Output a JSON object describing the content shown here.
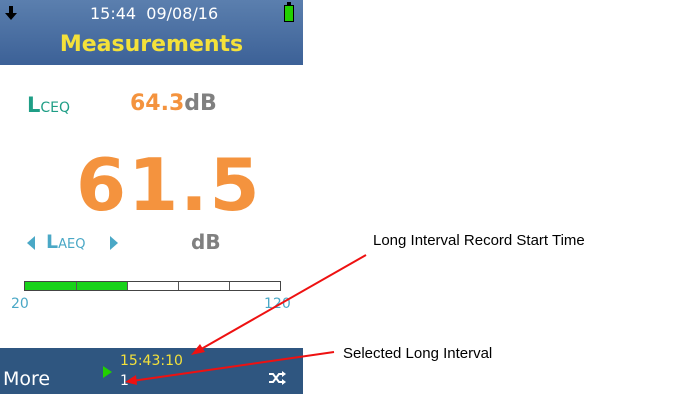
{
  "status_bar": {
    "time": "15:44",
    "date": "09/08/16"
  },
  "screen": {
    "title": "Measurements",
    "secondary": {
      "label_main": "L",
      "label_sub": "CEQ",
      "value": "64.3",
      "unit": "dB"
    },
    "primary": {
      "value": "61.5",
      "label_main": "L",
      "label_sub": "AEQ",
      "unit": "dB"
    },
    "level_bar": {
      "min": "20",
      "max": "120",
      "level_fraction": 0.4
    }
  },
  "footer": {
    "more_label": "More",
    "start_time": "15:43:10",
    "interval": "1"
  },
  "annotations": {
    "start_time": "Long Interval Record Start Time",
    "selected_interval": "Selected Long Interval"
  },
  "colors": {
    "header_bg": "#3c6197",
    "title": "#f4e13a",
    "value_orange": "#f4933e",
    "lceq_teal": "#1f9e86",
    "laeq_blue": "#4aa8c6",
    "bar_green": "#18d21a",
    "footer_bg": "#2f5680",
    "arrow_red": "#ee1111"
  }
}
